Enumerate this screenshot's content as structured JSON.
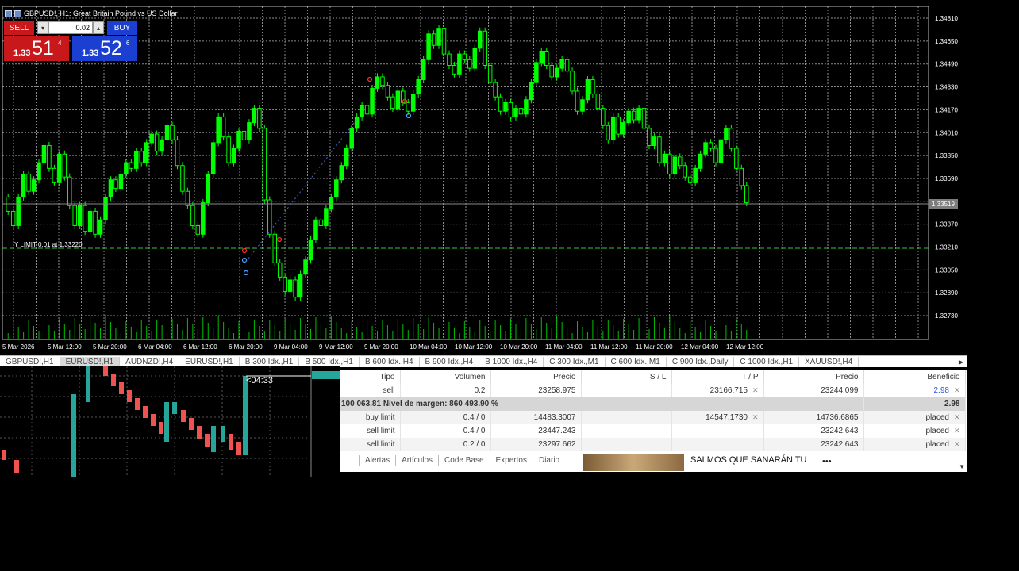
{
  "window": {
    "title": "GBPUSD!, H1:  Great Britain Pound vs US Dollar"
  },
  "one_click": {
    "sell_label": "SELL",
    "buy_label": "BUY",
    "lot": "0.02",
    "sell_price": {
      "prefix": "1.33",
      "big": "51",
      "sup": "4"
    },
    "buy_price": {
      "prefix": "1.33",
      "big": "52",
      "sup": "6"
    }
  },
  "chart": {
    "order_line_label": "Y LIMIT 0.01 at 1.33220",
    "current_price_label": "1.33519",
    "price_axis": [
      "1.34810",
      "1.34650",
      "1.34490",
      "1.34330",
      "1.34170",
      "1.34010",
      "1.33850",
      "1.33690",
      "1.33530",
      "1.33370",
      "1.33210",
      "1.33050",
      "1.32890",
      "1.32730"
    ],
    "time_axis": [
      "5 Mar 2026",
      "5 Mar 12:00",
      "5 Mar 20:00",
      "6 Mar 04:00",
      "6 Mar 12:00",
      "6 Mar 20:00",
      "9 Mar 04:00",
      "9 Mar 12:00",
      "9 Mar 20:00",
      "10 Mar 04:00",
      "10 Mar 12:00",
      "10 Mar 20:00",
      "11 Mar 04:00",
      "11 Mar 12:00",
      "11 Mar 20:00",
      "12 Mar 04:00",
      "12 Mar 12:00"
    ],
    "colors": {
      "background": "#000000",
      "bull": "#00ff00",
      "bear": "#000000",
      "grid": "#8c8c8c",
      "volume": "#00c000",
      "order_line": "#3cbf3c"
    }
  },
  "symbol_tabs": [
    {
      "label": "GBPUSD!,H1",
      "active": false
    },
    {
      "label": "EURUSD!,H1",
      "active": true
    },
    {
      "label": "AUDNZD!,H4",
      "active": false
    },
    {
      "label": "EURUSD!,H1",
      "active": false
    },
    {
      "label": "B 300 Idx.,H1",
      "active": false
    },
    {
      "label": "B 500 Idx.,H1",
      "active": false
    },
    {
      "label": "B 600 Idx.,H4",
      "active": false
    },
    {
      "label": "B 900 Idx.,H4",
      "active": false
    },
    {
      "label": "B 1000 Idx.,H4",
      "active": false
    },
    {
      "label": "C 300 Idx.,M1",
      "active": false
    },
    {
      "label": "C 600 Idx.,M1",
      "active": false
    },
    {
      "label": "C 900 Idx.,Daily",
      "active": false
    },
    {
      "label": "C 1000 Idx.,H1",
      "active": false
    },
    {
      "label": "XAUUSD!,H4",
      "active": false
    }
  ],
  "mini_chart": {
    "timer": "<04:33",
    "colors": {
      "bull": "#26a69a",
      "bear": "#ef5350"
    }
  },
  "terminal": {
    "headers": [
      "Tipo",
      "Volumen",
      "Precio",
      "S / L",
      "T / P",
      "Precio",
      "Beneficio"
    ],
    "rows": [
      {
        "tipo": "sell",
        "volumen": "0.2",
        "precio": "23258.975",
        "sl": "",
        "tp": "23166.715",
        "precio2": "23244.099",
        "beneficio": "2.98"
      }
    ],
    "summary": {
      "text": "100 063.81  Nivel de margen: 860 493.90 %",
      "value": "2.98"
    },
    "pending": [
      {
        "tipo": "buy limit",
        "volumen": "0.4 / 0",
        "precio": "14483.3007",
        "sl": "",
        "tp": "14547.1730",
        "precio2": "14736.6865",
        "estado": "placed"
      },
      {
        "tipo": "sell limit",
        "volumen": "0.4 / 0",
        "precio": "23447.243",
        "sl": "",
        "tp": "",
        "precio2": "23242.643",
        "estado": "placed"
      },
      {
        "tipo": "sell limit",
        "volumen": "0.2 / 0",
        "precio": "23297.662",
        "sl": "",
        "tp": "",
        "precio2": "23242.643",
        "estado": "placed"
      }
    ],
    "tabs": [
      "Alertas",
      "Artículos",
      "Code Base",
      "Expertos",
      "Diario"
    ],
    "ad_text": "SALMOS QUE SANARÁN TU",
    "more": "•••"
  }
}
